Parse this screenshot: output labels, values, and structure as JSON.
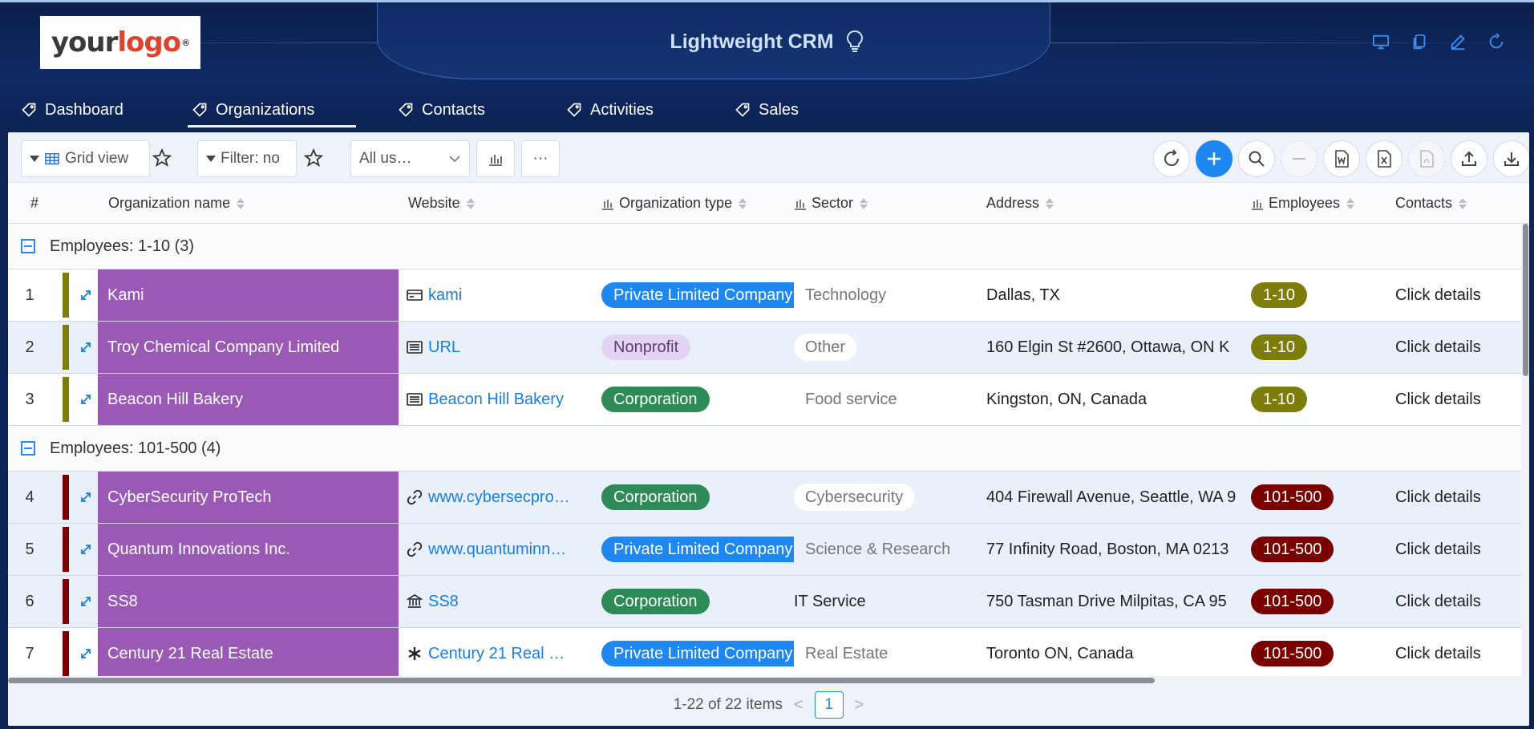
{
  "header": {
    "logo_a": "your",
    "logo_b": "logo",
    "logo_reg": "®",
    "app_title": "Lightweight CRM"
  },
  "tabs": [
    {
      "label": "Dashboard"
    },
    {
      "label": "Organizations"
    },
    {
      "label": "Contacts"
    },
    {
      "label": "Activities"
    },
    {
      "label": "Sales"
    }
  ],
  "toolbar": {
    "view_label": "Grid view",
    "filter_label": "Filter: no",
    "users_select": "All us…",
    "more_label": "···"
  },
  "columns": {
    "num": "#",
    "name": "Organization name",
    "website": "Website",
    "type": "Organization type",
    "sector": "Sector",
    "address": "Address",
    "employees": "Employees",
    "contacts": "Contacts"
  },
  "groups": [
    {
      "label": "Employees: 1-10 (3)"
    },
    {
      "label": "Employees: 101-500 (4)"
    }
  ],
  "rows": [
    {
      "num": "1",
      "name": "Kami",
      "website": "kami",
      "type": "Private Limited Company",
      "sector": "Technology",
      "address": "Dallas, TX",
      "employees": "1-10",
      "contacts": "Click details"
    },
    {
      "num": "2",
      "name": "Troy Chemical Company Limited",
      "website": "URL",
      "type": "Nonprofit",
      "sector": "Other",
      "address": "160 Elgin St #2600, Ottawa, ON K",
      "employees": "1-10",
      "contacts": "Click details"
    },
    {
      "num": "3",
      "name": "Beacon Hill Bakery",
      "website": "Beacon Hill Bakery",
      "type": "Corporation",
      "sector": "Food service",
      "address": "Kingston, ON, Canada",
      "employees": "1-10",
      "contacts": "Click details"
    },
    {
      "num": "4",
      "name": "CyberSecurity ProTech",
      "website": "www.cybersecpro…",
      "type": "Corporation",
      "sector": "Cybersecurity",
      "address": "404 Firewall Avenue, Seattle, WA 9",
      "employees": "101-500",
      "contacts": "Click details"
    },
    {
      "num": "5",
      "name": "Quantum Innovations Inc.",
      "website": "www.quantuminn…",
      "type": "Private Limited Company",
      "sector": "Science & Research",
      "address": "77 Infinity Road, Boston, MA 0213",
      "employees": "101-500",
      "contacts": "Click details"
    },
    {
      "num": "6",
      "name": "SS8",
      "website": "SS8",
      "type": "Corporation",
      "sector": "IT Service",
      "address": "750 Tasman Drive Milpitas, CA 95",
      "employees": "101-500",
      "contacts": "Click details"
    },
    {
      "num": "7",
      "name": "Century 21 Real Estate",
      "website": "Century 21 Real …",
      "type": "Private Limited Company",
      "sector": "Real Estate",
      "address": "Toronto ON, Canada",
      "employees": "101-500",
      "contacts": "Click details"
    }
  ],
  "footer": {
    "summary": "1-22 of 22 items",
    "page": "1",
    "prev": "<",
    "next": ">"
  },
  "colors": {
    "header_bg": "#0f2a63",
    "name_cell": "#9b59b6",
    "type_private": "#1e88f0",
    "type_corporation": "#2e8b57",
    "type_nonprofit": "#e3d4f4",
    "emp_small": "#7d7d0c",
    "emp_mid": "#7a0000"
  }
}
